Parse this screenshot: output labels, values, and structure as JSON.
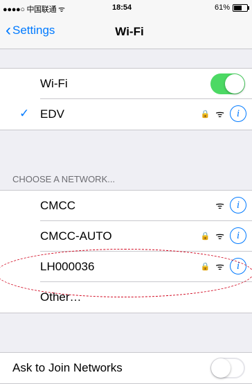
{
  "status_bar": {
    "carrier": "●●●●○ 中国联通 ᯤ",
    "time": "18:54",
    "battery_percent": "61%",
    "battery_level": 0.61
  },
  "nav": {
    "back_label": "Settings",
    "title": "Wi-Fi"
  },
  "wifi": {
    "label": "Wi-Fi",
    "enabled": true,
    "connected_network": "EDV"
  },
  "choose_network_header": "CHOOSE A NETWORK...",
  "networks": [
    {
      "name": "CMCC",
      "locked": false
    },
    {
      "name": "CMCC-AUTO",
      "locked": true
    },
    {
      "name": "LH000036",
      "locked": true
    },
    {
      "name": "Other…"
    }
  ],
  "ask_to_join": {
    "label": "Ask to Join Networks",
    "enabled": false
  },
  "colors": {
    "accent": "#007aff",
    "toggle_on": "#4cd964",
    "highlight": "#d0021b"
  }
}
